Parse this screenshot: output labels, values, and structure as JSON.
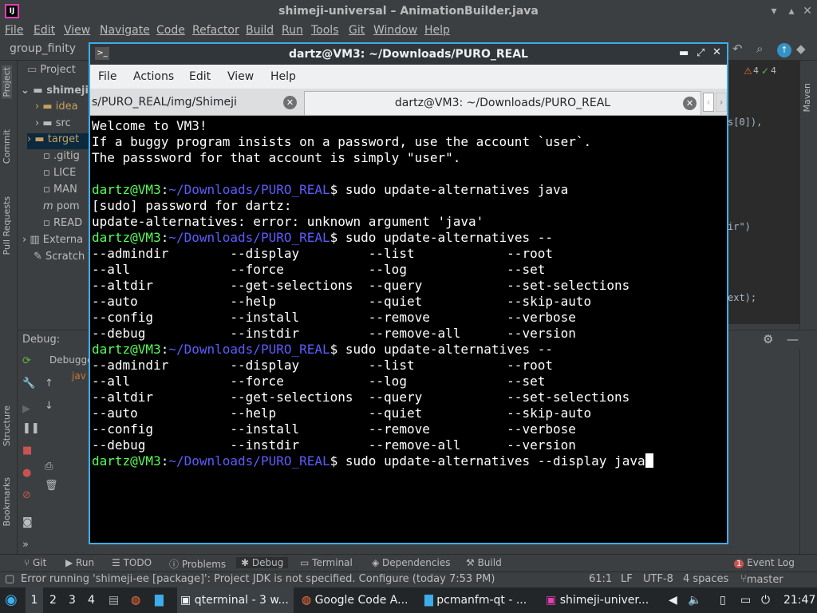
{
  "ide": {
    "title": "shimeji-universal – AnimationBuilder.java",
    "logo": "IJ",
    "menu": [
      "File",
      "Edit",
      "View",
      "Navigate",
      "Code",
      "Refactor",
      "Build",
      "Run",
      "Tools",
      "Git",
      "Window",
      "Help"
    ],
    "breadcrumb": "group_finity",
    "project": {
      "header": "Project",
      "items": [
        "shimeji",
        "idea",
        "src",
        "target",
        ".gitig",
        "LICE",
        "MAN",
        "pom",
        "READ",
        "Externa",
        "Scratch"
      ]
    },
    "left_strip": [
      "Project",
      "Commit",
      "Pull Requests",
      "Structure",
      "Bookmarks"
    ],
    "right_strip": [
      "Maven"
    ],
    "editor_fragments": {
      "inspection_count_a": "4",
      "inspection_count_b": "4",
      "line1": "s[0]),",
      "line2": "ir\")",
      "line3": "ext);"
    },
    "debug": {
      "label": "Debug:",
      "tab": "Debugger",
      "frame": "jav"
    },
    "tool_windows": [
      "Git",
      "Run",
      "TODO",
      "Problems",
      "Debug",
      "Terminal",
      "Dependencies",
      "Build"
    ],
    "event_log": "Event Log",
    "event_log_count": "1",
    "status": {
      "message": "Error running 'shimeji-ee [package]': Project JDK is not specified. Configure (today 7:53 PM)",
      "position": "61:1",
      "line_sep": "LF",
      "encoding": "UTF-8",
      "indent": "4 spaces",
      "branch": "master"
    }
  },
  "terminal": {
    "title": "dartz@VM3: ~/Downloads/PURO_REAL",
    "menu": [
      "File",
      "Actions",
      "Edit",
      "View",
      "Help"
    ],
    "tabs": [
      {
        "label": "s/PURO_REAL/img/Shimeji",
        "active": false
      },
      {
        "label": "dartz@VM3: ~/Downloads/PURO_REAL",
        "active": true
      }
    ],
    "prompt_user": "dartz@VM3",
    "prompt_path": "~/Downloads/PURO_REAL",
    "lines": [
      {
        "kind": "text",
        "text": "Welcome to VM3!"
      },
      {
        "kind": "text",
        "text": "If a buggy program insists on a password, use the account `user`."
      },
      {
        "kind": "text",
        "text": "The passsword for that account is simply \"user\"."
      },
      {
        "kind": "text",
        "text": ""
      },
      {
        "kind": "prompt",
        "cmd": "sudo update-alternatives java"
      },
      {
        "kind": "text",
        "text": "[sudo] password for dartz:"
      },
      {
        "kind": "text",
        "text": "update-alternatives: error: unknown argument 'java'"
      },
      {
        "kind": "prompt",
        "cmd": "sudo update-alternatives --"
      },
      {
        "kind": "text",
        "text": "--admindir        --display         --list            --root"
      },
      {
        "kind": "text",
        "text": "--all             --force           --log             --set"
      },
      {
        "kind": "text",
        "text": "--altdir          --get-selections  --query           --set-selections"
      },
      {
        "kind": "text",
        "text": "--auto            --help            --quiet           --skip-auto"
      },
      {
        "kind": "text",
        "text": "--config          --install         --remove          --verbose"
      },
      {
        "kind": "text",
        "text": "--debug           --instdir         --remove-all      --version"
      },
      {
        "kind": "prompt",
        "cmd": "sudo update-alternatives --"
      },
      {
        "kind": "text",
        "text": "--admindir        --display         --list            --root"
      },
      {
        "kind": "text",
        "text": "--all             --force           --log             --set"
      },
      {
        "kind": "text",
        "text": "--altdir          --get-selections  --query           --set-selections"
      },
      {
        "kind": "text",
        "text": "--auto            --help            --quiet           --skip-auto"
      },
      {
        "kind": "text",
        "text": "--config          --install         --remove          --verbose"
      },
      {
        "kind": "text",
        "text": "--debug           --instdir         --remove-all      --version"
      },
      {
        "kind": "prompt",
        "cmd": "sudo update-alternatives --display java",
        "cursor": true
      }
    ]
  },
  "taskbar": {
    "workspaces": [
      "1",
      "2",
      "3",
      "4"
    ],
    "tasks": [
      "qterminal - 3 w...",
      "Google Code A...",
      "pcmanfm-qt - ...",
      "shimeji-univer..."
    ],
    "clock": "21:47"
  },
  "colors": {
    "accent": "#3daee9",
    "prompt_user": "#55ff55",
    "prompt_path": "#5c5cff",
    "ide_bg": "#3c3f41"
  }
}
